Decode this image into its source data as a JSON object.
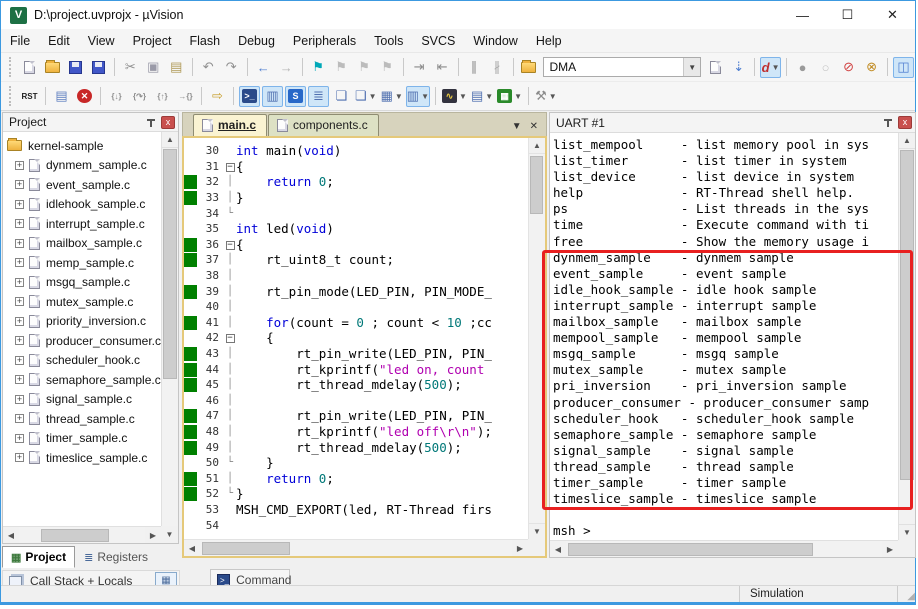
{
  "window": {
    "title": "D:\\project.uvprojx - µVision",
    "app_icon_text": "V",
    "controls": {
      "minimize": "—",
      "maximize": "☐",
      "close": "✕"
    }
  },
  "menu": [
    "File",
    "Edit",
    "View",
    "Project",
    "Flash",
    "Debug",
    "Peripherals",
    "Tools",
    "SVCS",
    "Window",
    "Help"
  ],
  "toolbar_top": {
    "dma_combo_value": "DMA",
    "groups": [
      {
        "items": [
          {
            "name": "new-file-icon",
            "type": "page"
          },
          {
            "name": "open-folder-icon",
            "type": "folder"
          },
          {
            "name": "save-icon",
            "type": "disk"
          },
          {
            "name": "save-all-icon",
            "type": "disk"
          }
        ]
      },
      {
        "items": [
          {
            "name": "cut-icon",
            "glyph": "✂",
            "color": "#8e8e8e"
          },
          {
            "name": "copy-icon",
            "glyph": "▣",
            "color": "#9a9aa8"
          },
          {
            "name": "paste-icon",
            "glyph": "▤",
            "color": "#b09a58"
          }
        ]
      },
      {
        "items": [
          {
            "name": "undo-icon",
            "glyph": "↶",
            "color": "#909090"
          },
          {
            "name": "redo-icon",
            "glyph": "↷",
            "color": "#909090"
          }
        ]
      },
      {
        "items": [
          {
            "name": "back-arrow-icon",
            "glyph": "←",
            "color": "#4f7fd0"
          },
          {
            "name": "forward-arrow-icon",
            "glyph": "→",
            "color": "#b5b5b5"
          }
        ]
      },
      {
        "items": [
          {
            "name": "bookmark-toggle-icon",
            "glyph": "⚑",
            "color": "#00a8b8"
          },
          {
            "name": "bookmark-prev-icon",
            "glyph": "⚑",
            "color": "#bcbcbc"
          },
          {
            "name": "bookmark-next-icon",
            "glyph": "⚑",
            "color": "#bcbcbc"
          },
          {
            "name": "bookmark-clear-icon",
            "glyph": "⚑",
            "color": "#bcbcbc"
          }
        ]
      },
      {
        "items": [
          {
            "name": "indent-icon",
            "glyph": "⇥",
            "color": "#8a8a8a"
          },
          {
            "name": "outdent-icon",
            "glyph": "⇤",
            "color": "#8a8a8a"
          }
        ]
      },
      {
        "items": [
          {
            "name": "comment-icon",
            "glyph": "∥",
            "color": "#8a8a8a"
          },
          {
            "name": "uncomment-icon",
            "glyph": "∦",
            "color": "#aaaaaa"
          }
        ]
      },
      {
        "items": [
          {
            "name": "find-in-files-icon",
            "type": "folder"
          }
        ],
        "combo_after": true
      },
      {
        "items": [
          {
            "name": "find-icon",
            "type": "page"
          },
          {
            "name": "incremental-find-icon",
            "glyph": "⇣",
            "color": "#4f7fd0"
          }
        ]
      },
      {
        "items": [
          {
            "name": "start-stop-debug-icon",
            "glyph": "d",
            "color": "#c03030",
            "pressed": true,
            "dd": true
          }
        ]
      },
      {
        "items": [
          {
            "name": "insert-breakpoint-icon",
            "glyph": "●",
            "color": "#9a9a9a"
          },
          {
            "name": "enable-breakpoint-icon",
            "glyph": "○",
            "color": "#c4c4c4"
          },
          {
            "name": "disable-all-breakpoints-icon",
            "glyph": "⊘",
            "color": "#d04040"
          },
          {
            "name": "kill-all-breakpoints-icon",
            "glyph": "⊗",
            "color": "#c08a20"
          }
        ]
      },
      {
        "items": [
          {
            "name": "window-layout-icon",
            "glyph": "◫",
            "color": "#4f7fd0",
            "pressed": true
          }
        ]
      }
    ]
  },
  "toolbar_debug": {
    "groups": [
      {
        "items": [
          {
            "name": "reset-icon",
            "text": "RST",
            "color": "#202020"
          }
        ]
      },
      {
        "items": [
          {
            "name": "run-icon",
            "glyph": "▤",
            "color": "#6080c0"
          },
          {
            "name": "stop-icon",
            "glyph": "✕",
            "circle": "#c82828"
          }
        ]
      },
      {
        "items": [
          {
            "name": "step-into-icon",
            "text": "{↓}",
            "color": "#8e8e8e"
          },
          {
            "name": "step-over-icon",
            "text": "{↷}",
            "color": "#8e8e8e"
          },
          {
            "name": "step-out-icon",
            "text": "{↑}",
            "color": "#8e8e8e"
          },
          {
            "name": "run-to-cursor-icon",
            "text": "→{}",
            "color": "#8e8e8e"
          }
        ]
      },
      {
        "items": [
          {
            "name": "show-next-statement-icon",
            "glyph": "⇨",
            "color": "#c8a030"
          }
        ]
      },
      {
        "items": [
          {
            "name": "command-window-icon",
            "text": ">_",
            "box": "#2a4a8a",
            "pressed": true
          },
          {
            "name": "disassembly-window-icon",
            "glyph": "▥",
            "color": "#5070b0",
            "pressed": true
          },
          {
            "name": "symbols-window-icon",
            "text": "S",
            "box": "#2868c8",
            "pressed": true
          },
          {
            "name": "registers-window-icon",
            "glyph": "≣",
            "color": "#5070b0",
            "pressed": true
          },
          {
            "name": "call-stack-window-icon",
            "glyph": "❏",
            "color": "#5070b0"
          },
          {
            "name": "watch-window-icon",
            "glyph": "❏",
            "color": "#5070b0",
            "dd": true
          },
          {
            "name": "memory-window-icon",
            "glyph": "▦",
            "color": "#5070b0",
            "dd": true
          },
          {
            "name": "serial-window-icon",
            "glyph": "▥",
            "color": "#5070b0",
            "pressed": true,
            "dd": true
          }
        ]
      },
      {
        "items": [
          {
            "name": "analysis-window-icon",
            "glyph": "∿",
            "box": "#32323e",
            "dd": true
          },
          {
            "name": "system-viewer-icon",
            "glyph": "▤",
            "color": "#5070b0",
            "dd": true
          },
          {
            "name": "toolbox-icon",
            "glyph": "▦",
            "box": "#2a8a2a",
            "dd": true
          }
        ]
      },
      {
        "items": [
          {
            "name": "debug-settings-icon",
            "glyph": "⚒",
            "color": "#8a8a8a",
            "dd": true
          }
        ]
      }
    ]
  },
  "project_panel": {
    "title": "Project",
    "root": "kernel-sample",
    "files": [
      "dynmem_sample.c",
      "event_sample.c",
      "idlehook_sample.c",
      "interrupt_sample.c",
      "mailbox_sample.c",
      "memp_sample.c",
      "msgq_sample.c",
      "mutex_sample.c",
      "priority_inversion.c",
      "producer_consumer.c",
      "scheduler_hook.c",
      "semaphore_sample.c",
      "signal_sample.c",
      "thread_sample.c",
      "timer_sample.c",
      "timeslice_sample.c"
    ],
    "tabs": [
      {
        "label": "Project",
        "active": true
      },
      {
        "label": "Registers",
        "active": false
      }
    ]
  },
  "editor": {
    "tabs": [
      {
        "label": "main.c",
        "active": true
      },
      {
        "label": "components.c",
        "active": false
      }
    ],
    "lines": [
      {
        "n": 30,
        "text": "int main(void)",
        "covered": false,
        "fold": ""
      },
      {
        "n": 31,
        "text": "{",
        "covered": false,
        "fold": "box"
      },
      {
        "n": 32,
        "text": "    return 0;",
        "covered": true,
        "fold": "line"
      },
      {
        "n": 33,
        "text": "}",
        "covered": true,
        "fold": "line"
      },
      {
        "n": 34,
        "text": "",
        "covered": false,
        "fold": "end"
      },
      {
        "n": 35,
        "text": "int led(void)",
        "covered": false,
        "fold": ""
      },
      {
        "n": 36,
        "text": "{",
        "covered": true,
        "fold": "box"
      },
      {
        "n": 37,
        "text": "    rt_uint8_t count;",
        "covered": true,
        "fold": "line"
      },
      {
        "n": 38,
        "text": "",
        "covered": false,
        "fold": "line"
      },
      {
        "n": 39,
        "text": "    rt_pin_mode(LED_PIN, PIN_MODE_",
        "covered": true,
        "fold": "line"
      },
      {
        "n": 40,
        "text": "",
        "covered": false,
        "fold": "line"
      },
      {
        "n": 41,
        "text": "    for(count = 0 ; count < 10 ;cc",
        "covered": true,
        "fold": "line"
      },
      {
        "n": 42,
        "text": "    {",
        "covered": false,
        "fold": "box"
      },
      {
        "n": 43,
        "text": "        rt_pin_write(LED_PIN, PIN_",
        "covered": true,
        "fold": "line"
      },
      {
        "n": 44,
        "text": "        rt_kprintf(\"led on, count",
        "covered": true,
        "fold": "line"
      },
      {
        "n": 45,
        "text": "        rt_thread_mdelay(500);",
        "covered": true,
        "fold": "line"
      },
      {
        "n": 46,
        "text": "",
        "covered": false,
        "fold": "line"
      },
      {
        "n": 47,
        "text": "        rt_pin_write(LED_PIN, PIN_",
        "covered": true,
        "fold": "line"
      },
      {
        "n": 48,
        "text": "        rt_kprintf(\"led off\\r\\n\");",
        "covered": true,
        "fold": "line"
      },
      {
        "n": 49,
        "text": "        rt_thread_mdelay(500);",
        "covered": true,
        "fold": "line"
      },
      {
        "n": 50,
        "text": "    }",
        "covered": false,
        "fold": "end"
      },
      {
        "n": 51,
        "text": "    return 0;",
        "covered": true,
        "fold": "line"
      },
      {
        "n": 52,
        "text": "}",
        "covered": true,
        "fold": "end"
      },
      {
        "n": 53,
        "text": "MSH_CMD_EXPORT(led, RT-Thread firs",
        "covered": false,
        "fold": ""
      },
      {
        "n": 54,
        "text": "",
        "covered": false,
        "fold": ""
      }
    ],
    "syntax_colors": {
      "keyword": "#0000d8",
      "number": "#007878",
      "string": "#b000b0"
    }
  },
  "uart_panel": {
    "title": "UART #1",
    "lines": [
      "list_mempool     - list memory pool in sys",
      "list_timer       - list timer in system",
      "list_device      - list device in system",
      "help             - RT-Thread shell help.",
      "ps               - List threads in the sys",
      "time             - Execute command with ti",
      "free             - Show the memory usage i",
      "dynmem_sample    - dynmem sample",
      "event_sample     - event sample",
      "idle_hook_sample - idle hook sample",
      "interrupt_sample - interrupt sample",
      "mailbox_sample   - mailbox sample",
      "mempool_sample   - mempool sample",
      "msgq_sample      - msgq sample",
      "mutex_sample     - mutex sample",
      "pri_inversion    - pri_inversion sample",
      "producer_consumer - producer_consumer samp",
      "scheduler_hook   - scheduler_hook sample",
      "semaphore_sample - semaphore sample",
      "signal_sample    - signal sample",
      "thread_sample    - thread sample",
      "timer_sample     - timer sample",
      "timeslice_sample - timeslice sample"
    ],
    "prompt": "msh >",
    "highlight_box_color": "#e82020"
  },
  "bottom": {
    "call_stack_label": "Call Stack + Locals",
    "command_tab_label": "Command"
  },
  "statusbar": {
    "mode": "Simulation"
  },
  "colors": {
    "coverage_green": "#008000",
    "active_tab_bg": "#faf3d2",
    "inactive_tab_bg": "#dde1c4",
    "editor_frame": "#e5c97a",
    "window_border": "#3c99e0",
    "close_button": "#c9504e"
  }
}
